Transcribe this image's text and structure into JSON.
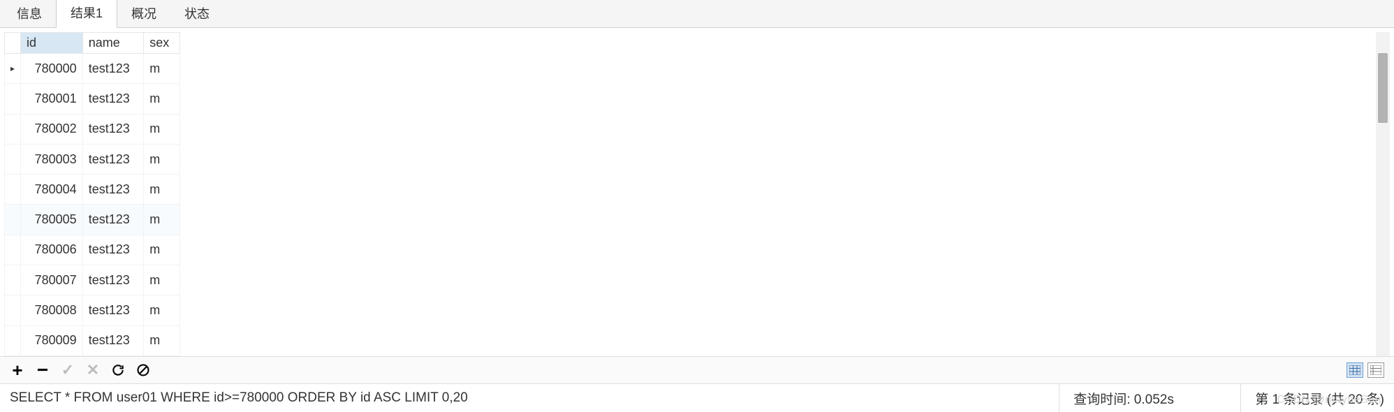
{
  "tabs": [
    {
      "label": "信息"
    },
    {
      "label": "结果1",
      "active": true
    },
    {
      "label": "概况"
    },
    {
      "label": "状态"
    }
  ],
  "columns": {
    "id": "id",
    "name": "name",
    "sex": "sex"
  },
  "rows": [
    {
      "marker": "▸",
      "id": "780000",
      "name": "test123",
      "sex": "m"
    },
    {
      "marker": "",
      "id": "780001",
      "name": "test123",
      "sex": "m"
    },
    {
      "marker": "",
      "id": "780002",
      "name": "test123",
      "sex": "m"
    },
    {
      "marker": "",
      "id": "780003",
      "name": "test123",
      "sex": "m"
    },
    {
      "marker": "",
      "id": "780004",
      "name": "test123",
      "sex": "m"
    },
    {
      "marker": "",
      "id": "780005",
      "name": "test123",
      "sex": "m",
      "alt": true
    },
    {
      "marker": "",
      "id": "780006",
      "name": "test123",
      "sex": "m"
    },
    {
      "marker": "",
      "id": "780007",
      "name": "test123",
      "sex": "m"
    },
    {
      "marker": "",
      "id": "780008",
      "name": "test123",
      "sex": "m"
    },
    {
      "marker": "",
      "id": "780009",
      "name": "test123",
      "sex": "m"
    }
  ],
  "toolbar": {
    "add": "＋",
    "remove": "—",
    "apply": "✔",
    "cancel": "✖",
    "refresh": "refresh",
    "stop": "stop"
  },
  "status": {
    "sql": "SELECT * FROM user01  WHERE id>=780000  ORDER BY id ASC  LIMIT 0,20",
    "time": "查询时间: 0.052s",
    "pos": "第 1 条记录 (共 20 条)"
  },
  "watermark": "CSDN @maybeSun"
}
